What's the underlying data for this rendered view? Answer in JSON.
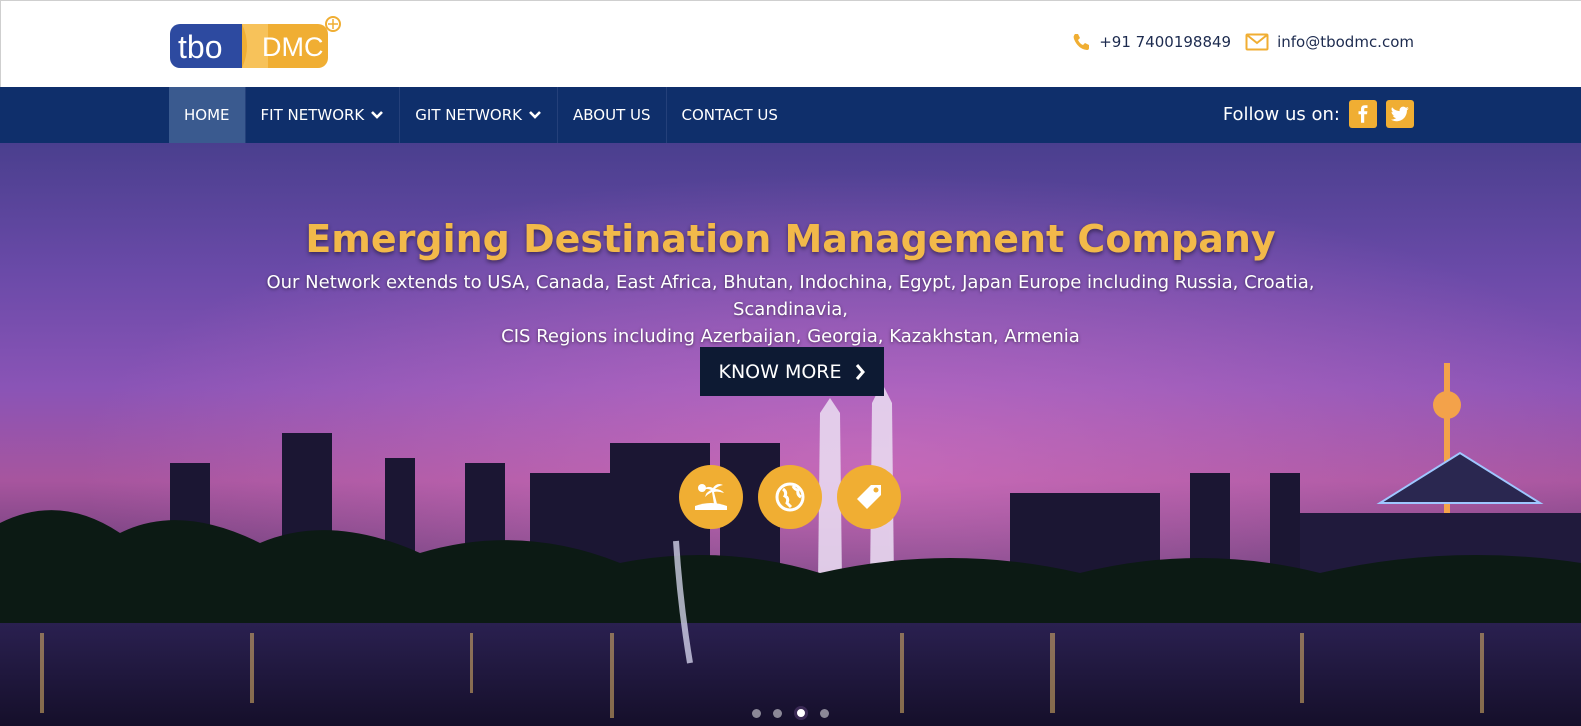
{
  "header": {
    "logo": {
      "text_left": "tbo",
      "text_right": "DMC"
    },
    "phone": "+91 7400198849",
    "email": "info@tbodmc.com",
    "icons": {
      "phone": "phone-icon",
      "email": "envelope-icon"
    }
  },
  "nav": {
    "items": [
      {
        "label": "HOME",
        "active": true,
        "dropdown": false
      },
      {
        "label": "FIT NETWORK",
        "active": false,
        "dropdown": true
      },
      {
        "label": "GIT NETWORK",
        "active": false,
        "dropdown": true
      },
      {
        "label": "ABOUT US",
        "active": false,
        "dropdown": false
      },
      {
        "label": "CONTACT US",
        "active": false,
        "dropdown": false
      }
    ],
    "follow_label": "Follow us on:",
    "social": [
      "facebook-icon",
      "twitter-icon"
    ]
  },
  "hero": {
    "title": "Emerging Destination Management Company",
    "text_line1": "Our Network extends to USA, Canada, East Africa, Bhutan, Indochina, Egypt, Japan Europe including Russia, Croatia, Scandinavia,",
    "text_line2": "CIS Regions including Azerbaijan, Georgia, Kazakhstan, Armenia",
    "button_label": "KNOW MORE",
    "feature_icons": [
      "beach-icon",
      "globe-icon",
      "tag-icon"
    ],
    "carousel": {
      "slides": 4,
      "active_index": 2
    }
  },
  "colors": {
    "nav_bg": "#0f2f6b",
    "accent": "#f0ae33",
    "title": "#f2b94a",
    "button_bg": "#0d1a33"
  }
}
